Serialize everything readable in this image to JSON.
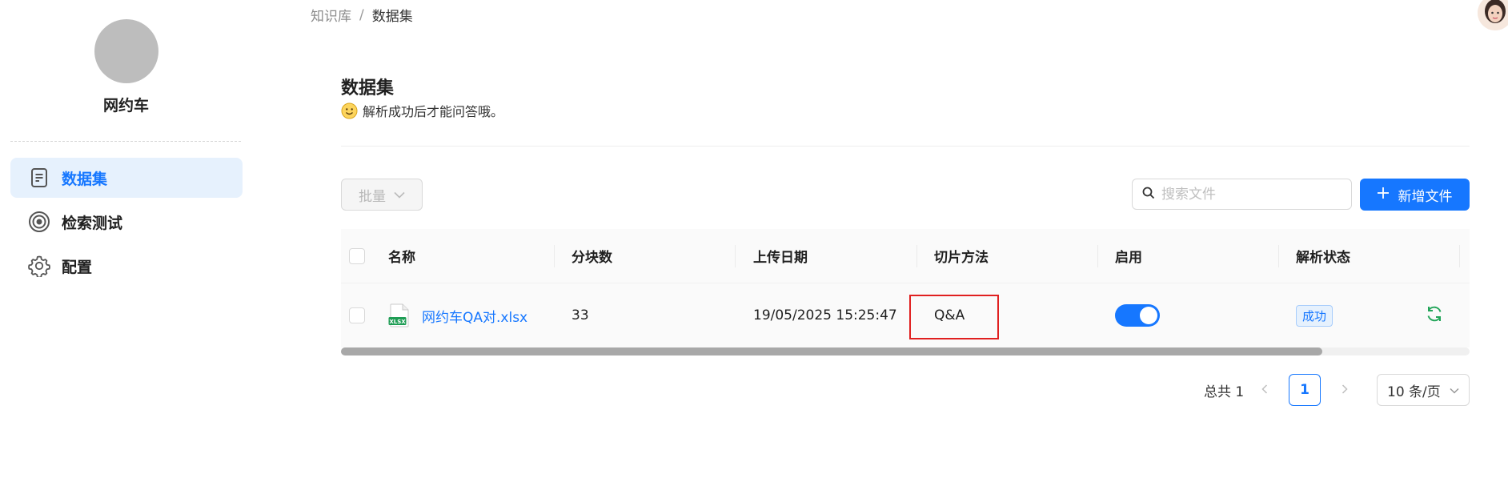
{
  "sidebar": {
    "kb_name": "网约车",
    "items": [
      {
        "label": "数据集",
        "icon": "document-icon",
        "active": true
      },
      {
        "label": "检索测试",
        "icon": "target-icon",
        "active": false
      },
      {
        "label": "配置",
        "icon": "gear-icon",
        "active": false
      }
    ]
  },
  "breadcrumb": {
    "root": "知识库",
    "separator": "/",
    "current": "数据集"
  },
  "main": {
    "title": "数据集",
    "subtitle": "解析成功后才能问答哦。",
    "batch_label": "批量",
    "search_placeholder": "搜索文件",
    "add_label": "新增文件"
  },
  "table": {
    "columns": [
      "名称",
      "分块数",
      "上传日期",
      "切片方法",
      "启用",
      "解析状态"
    ],
    "rows": [
      {
        "name": "网约车QA对.xlsx",
        "file_icon": "xlsx-icon",
        "chunks": "33",
        "upload_date": "19/05/2025 15:25:47",
        "method": "Q&A",
        "enabled": true,
        "status": "成功"
      }
    ]
  },
  "pagination": {
    "total": "总共 1",
    "current_page": "1",
    "page_size": "10 条/页"
  },
  "colors": {
    "accent": "#1677ff",
    "highlight_border": "#e02020",
    "success_icon": "#22a559"
  }
}
